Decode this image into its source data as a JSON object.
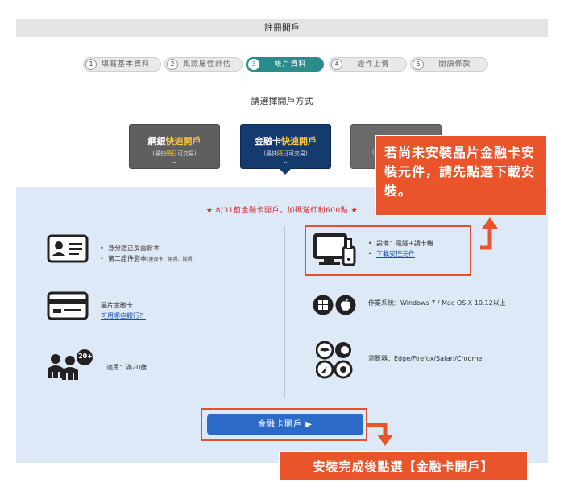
{
  "header": {
    "title": "註冊開戶"
  },
  "steps": [
    {
      "num": "1",
      "label": "填寫基本資料"
    },
    {
      "num": "2",
      "label": "風險屬性評估"
    },
    {
      "num": "3",
      "label": "帳戶資料"
    },
    {
      "num": "4",
      "label": "證件上傳"
    },
    {
      "num": "5",
      "label": "閱讀條款"
    }
  ],
  "subtitle": "請選擇開戶方式",
  "methods": {
    "net": {
      "title_a": "網銀",
      "title_b": "快速開戶",
      "sub_a": "(最快",
      "sub_b": "隔日",
      "sub_c": "可交易)"
    },
    "debit": {
      "title_a": "金融卡",
      "title_b": "快速開戶",
      "sub_a": "(最快",
      "sub_b": "隔日",
      "sub_c": "可交易)"
    },
    "third": {
      "sub_a": "("
    }
  },
  "promo": "★ 8/31前金融卡開戶，加碼送紅利600點 ★",
  "requirements": {
    "id_docs": {
      "item1": "身分證正反面影本",
      "item2": "第二證件影本",
      "item2_note": "(健保卡、駕照、護照)"
    },
    "chip_card": {
      "label": "晶片金融卡",
      "link": "可用哪些銀行？"
    },
    "age": {
      "badge": "20+",
      "label": "適用：滿20歲"
    },
    "device": {
      "item1": "設備：電腦+讀卡機",
      "item2": "下載安控元件"
    },
    "os": {
      "label": "作業系統：Windows 7 / Mac OS X 10.12以上"
    },
    "browser": {
      "label": "瀏覽器：Edge/Firefox/Safari/Chrome"
    }
  },
  "cta": {
    "label": "金融卡開戶 ▶"
  },
  "annotations": {
    "note1": "若尚未安裝晶片金融卡安裝元件，請先點選下載安裝。",
    "note2": "安裝完成後點選【金融卡開戶】"
  },
  "colors": {
    "accent_teal": "#2a8c8c",
    "navy": "#153a6e",
    "cta_blue": "#2c6ac8",
    "promo_red": "#d3262a",
    "annotation_orange": "#e9542b",
    "panel_bg": "#dde9f6"
  }
}
